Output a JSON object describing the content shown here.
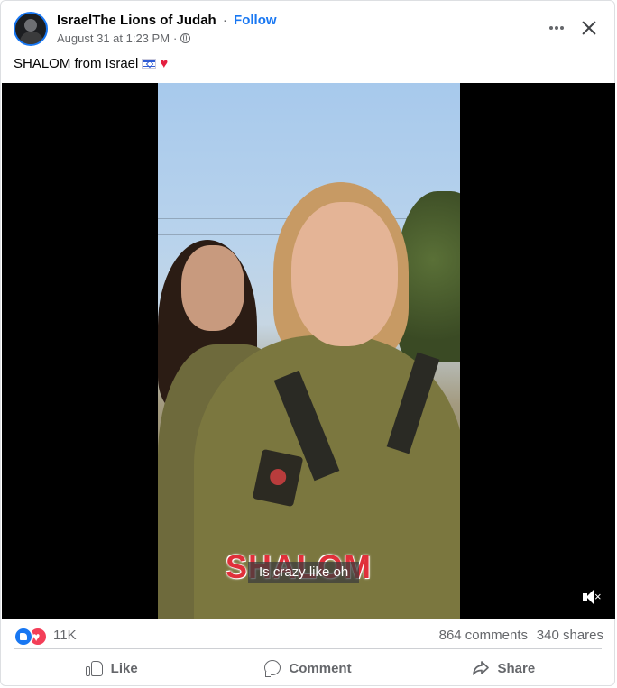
{
  "header": {
    "page_name": "IsraelThe Lions of Judah",
    "separator": "·",
    "follow_label": "Follow",
    "timestamp": "August 31 at 1:23 PM",
    "meta_separator": "·",
    "audience_icon": "globe-icon",
    "more_icon": "more-horizontal-icon",
    "close_icon": "close-icon"
  },
  "post": {
    "caption": "SHALOM from Israel",
    "caption_emojis": [
      "israel-flag-icon",
      "red-heart-icon"
    ]
  },
  "video": {
    "overlay_title": "SHALOM",
    "subtitle": "Is crazy like oh",
    "volume_icon": "volume-muted-icon"
  },
  "stats": {
    "reactions": [
      "like-reaction-icon",
      "love-reaction-icon"
    ],
    "reaction_count": "11K",
    "comments": "864 comments",
    "shares": "340 shares"
  },
  "actions": {
    "like_label": "Like",
    "comment_label": "Comment",
    "share_label": "Share"
  },
  "colors": {
    "accent": "#1877f2",
    "love": "#f33e58",
    "secondary_text": "#65676b"
  }
}
